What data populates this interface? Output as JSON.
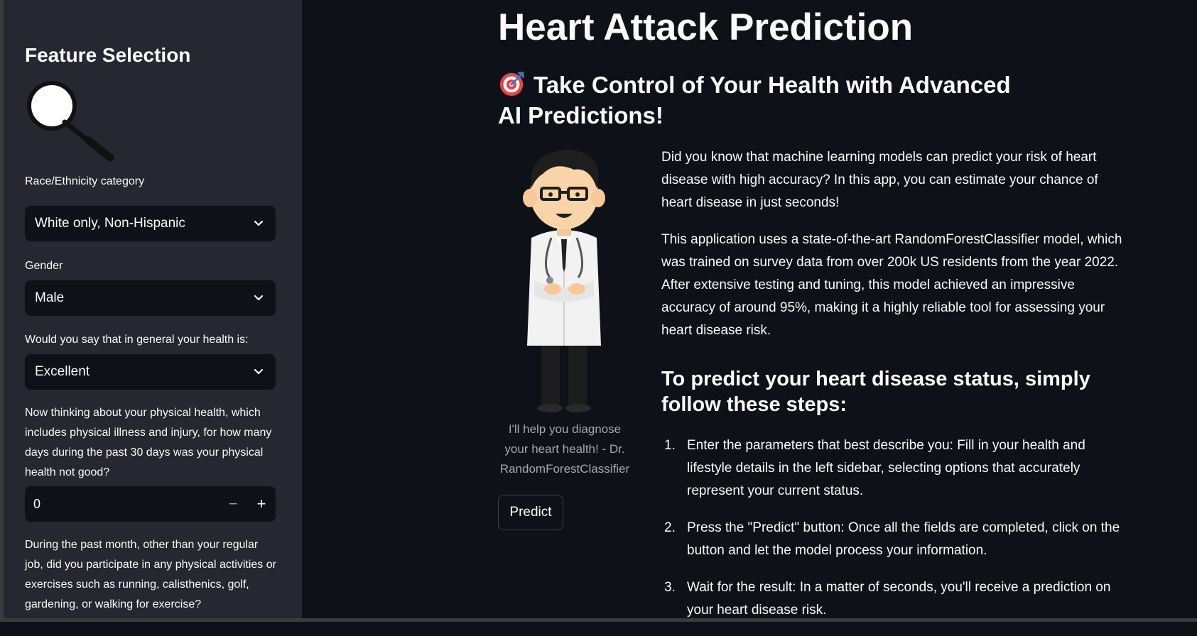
{
  "sidebar": {
    "title": "Feature Selection",
    "fields": [
      {
        "label": "Race/Ethnicity category",
        "value": "White only, Non-Hispanic"
      },
      {
        "label": "Gender",
        "value": "Male"
      },
      {
        "label": "Would you say that in general your health is:",
        "value": "Excellent"
      }
    ],
    "physical_health": {
      "label": "Now thinking about your physical health, which includes physical illness and injury, for how many days during the past 30 days was your physical health not good?",
      "value": "0",
      "minus": "−",
      "plus": "+"
    },
    "exercise_label": "During the past month, other than your regular job, did you participate in any physical activities or exercises such as running, calisthenics, golf, gardening, or walking for exercise?"
  },
  "main": {
    "title": "Heart Attack Prediction",
    "subtitle": "Take Control of Your Health with Advanced AI Predictions!",
    "caption": "I'll help you diagnose your heart health! - Dr. RandomForestClassifier",
    "predict_label": "Predict",
    "intro": "Did you know that machine learning models can predict your risk of heart disease with high accuracy? In this app, you can estimate your chance of heart disease in just seconds!",
    "description": "This application uses a state-of-the-art RandomForestClassifier model, which was trained on survey data from over 200k US residents from the year 2022. After extensive testing and tuning, this model achieved an impressive accuracy of around 95%, making it a highly reliable tool for assessing your heart disease risk.",
    "steps_heading": "To predict your heart disease status, simply follow these steps:",
    "steps": [
      {
        "num": "1.",
        "text": "Enter the parameters that best describe you: Fill in your health and lifestyle details in the left sidebar, selecting options that accurately represent your current status."
      },
      {
        "num": "2.",
        "text": "Press the \"Predict\" button: Once all the fields are completed, click on the button and let the model process your information."
      },
      {
        "num": "3.",
        "text": "Wait for the result: In a matter of seconds, you'll receive a prediction on your heart disease risk."
      }
    ]
  },
  "icons": {
    "title_icon": "target-arrow-icon",
    "sidebar_image": "magnifying-glass-icon",
    "doctor_image": "doctor-illustration"
  },
  "colors": {
    "background": "#0e1117",
    "sidebar": "#262730",
    "caption": "#a3a8b4"
  }
}
